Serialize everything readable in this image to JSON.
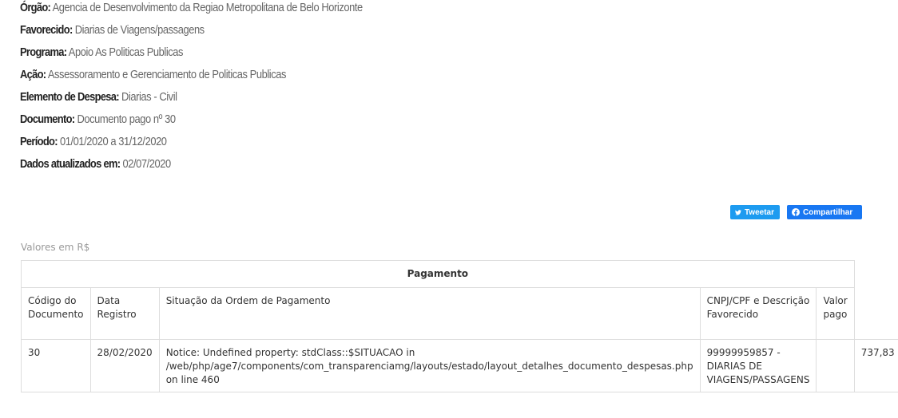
{
  "info": [
    {
      "key": "Órgão:",
      "value": "Agencia de Desenvolvimento da Regiao Metropolitana de Belo Horizonte"
    },
    {
      "key": "Favorecido:",
      "value": "Diarias de Viagens/passagens"
    },
    {
      "key": "Programa:",
      "value": "Apoio As Politicas Publicas"
    },
    {
      "key": "Ação:",
      "value": "Assessoramento e Gerenciamento de Politicas Publicas"
    },
    {
      "key": "Elemento de Despesa:",
      "value": "Diarias - Civil"
    },
    {
      "key": "Documento:",
      "value": "Documento pago nº 30"
    },
    {
      "key": "Período:",
      "value": "01/01/2020 a 31/12/2020"
    },
    {
      "key": "Dados atualizados em:",
      "value": "02/07/2020"
    }
  ],
  "share": {
    "tweet_label": "Tweetar",
    "facebook_label": "Compartilhar"
  },
  "values_label": "Valores em R$",
  "table": {
    "group_header": "Pagamento",
    "columns": [
      "Código do Documento",
      "Data Registro",
      "Situação da Ordem de Pagamento",
      "CNPJ/CPF e Descrição Favorecido",
      "Valor pago"
    ],
    "rows": [
      {
        "codigo": "30",
        "data": "28/02/2020",
        "situacao": "Notice: Undefined property: stdClass::$SITUACAO in /web/php/age7/components/com_transparenciamg/layouts/estado/layout_detalhes_documento_despesas.php on line 460",
        "favorecido": "99999959857 - DIARIAS DE VIAGENS/PASSAGENS",
        "valor": "737,83"
      }
    ]
  }
}
